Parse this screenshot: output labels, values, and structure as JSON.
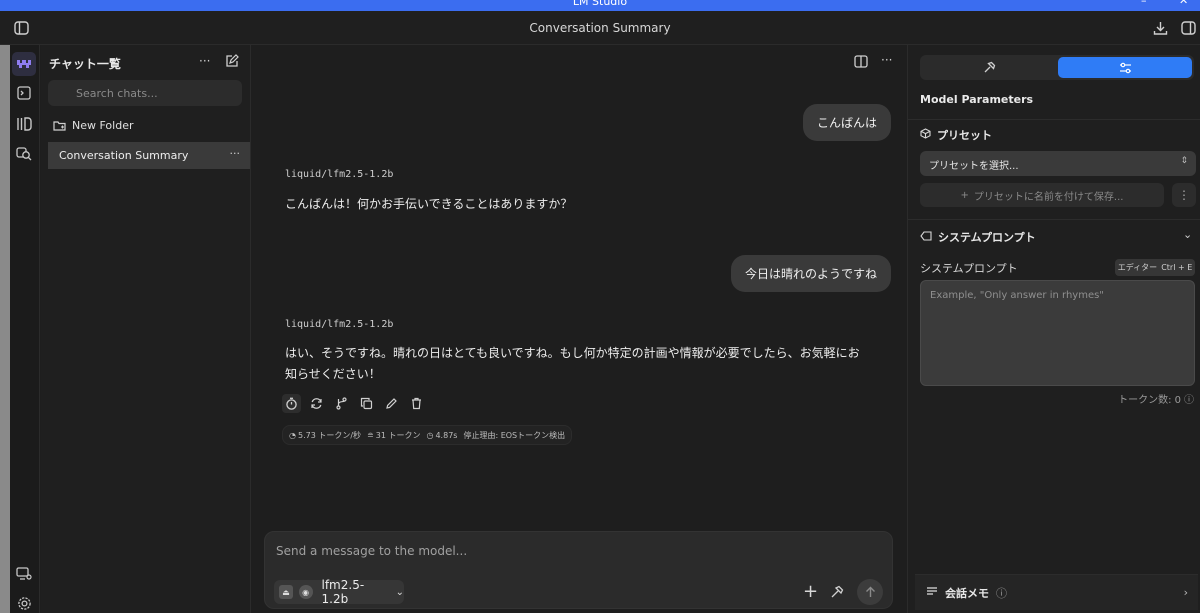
{
  "window": {
    "title": "LM Studio"
  },
  "topbar": {
    "title": "Conversation Summary"
  },
  "sidebar": {
    "header": "チャット一覧",
    "search_placeholder": "Search chats...",
    "new_folder": "New Folder",
    "conversations": [
      {
        "label": "Conversation Summary",
        "selected": true
      }
    ]
  },
  "chat": {
    "messages": [
      {
        "role": "user",
        "text": "こんばんは"
      },
      {
        "role": "assistant",
        "model": "liquid/lfm2.5-1.2b",
        "text": "こんばんは！何かお手伝いできることはありますか？"
      },
      {
        "role": "user",
        "text": "今日は晴れのようですね"
      },
      {
        "role": "assistant",
        "model": "liquid/lfm2.5-1.2b",
        "text": "はい、そうですね。晴れの日はとても良いですね。もし何か特定の計画や情報が必要でしたら、お気軽にお知らせください！"
      }
    ],
    "stats": {
      "speed": "5.73 トークン/秒",
      "tokens": "31 トークン",
      "time": "4.87s",
      "stop_reason": "停止理由: EOSトークン検出"
    }
  },
  "composer": {
    "placeholder": "Send a message to the model...",
    "model_name": "lfm2.5-1.2b"
  },
  "right_panel": {
    "heading": "Model Parameters",
    "preset": {
      "title": "プリセット",
      "select_label": "プリセットを選択...",
      "save_label": "プリセットに名前を付けて保存..."
    },
    "system_prompt": {
      "title": "システムプロンプト",
      "label": "システムプロンプト",
      "editor_label": "エディター",
      "editor_shortcut": "Ctrl + E",
      "placeholder": "Example, \"Only answer in rhymes\"",
      "token_count": "トークン数: 0"
    },
    "memo": {
      "title": "会話メモ"
    }
  },
  "colors": {
    "accent": "#2f7cf6",
    "titlebar": "#3b6df0",
    "background": "#1e1e1e",
    "bubble": "#3a3a3a"
  }
}
